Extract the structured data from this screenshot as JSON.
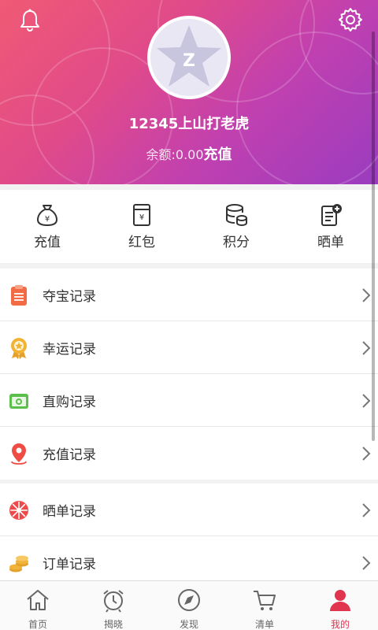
{
  "header": {
    "username": "12345上山打老虎",
    "balance_label": "余额:",
    "balance_value": "0.00",
    "recharge_link": "充值",
    "icons": {
      "left": "bell-icon",
      "right": "gear-icon"
    },
    "avatar": "default-avatar-star"
  },
  "quick_actions": [
    {
      "label": "充值",
      "icon": "money-bag-icon"
    },
    {
      "label": "红包",
      "icon": "red-envelope-icon"
    },
    {
      "label": "积分",
      "icon": "points-database-icon"
    },
    {
      "label": "晒单",
      "icon": "share-document-icon"
    }
  ],
  "records_group1": [
    {
      "label": "夺宝记录",
      "icon": "clipboard-icon",
      "color": "#f36b44"
    },
    {
      "label": "幸运记录",
      "icon": "medal-icon",
      "color": "#f2b335"
    },
    {
      "label": "直购记录",
      "icon": "camera-icon",
      "color": "#5cbf4b"
    },
    {
      "label": "充值记录",
      "icon": "location-pin-icon",
      "color": "#ef4c46"
    }
  ],
  "records_group2": [
    {
      "label": "晒单记录",
      "icon": "flower-icon",
      "color": "#ef4a4a"
    },
    {
      "label": "订单记录",
      "icon": "coins-icon",
      "color": "#f0b43a"
    }
  ],
  "tabbar": {
    "items": [
      {
        "label": "首页",
        "icon": "home-icon"
      },
      {
        "label": "揭晓",
        "icon": "alarm-clock-icon"
      },
      {
        "label": "发现",
        "icon": "compass-icon"
      },
      {
        "label": "清单",
        "icon": "cart-icon"
      },
      {
        "label": "我的",
        "icon": "user-icon",
        "active": true
      }
    ],
    "active_color": "#e1344f"
  },
  "colors": {
    "accent": "#e1344f",
    "header_start": "#f05a74",
    "header_end": "#9a3cc0"
  }
}
